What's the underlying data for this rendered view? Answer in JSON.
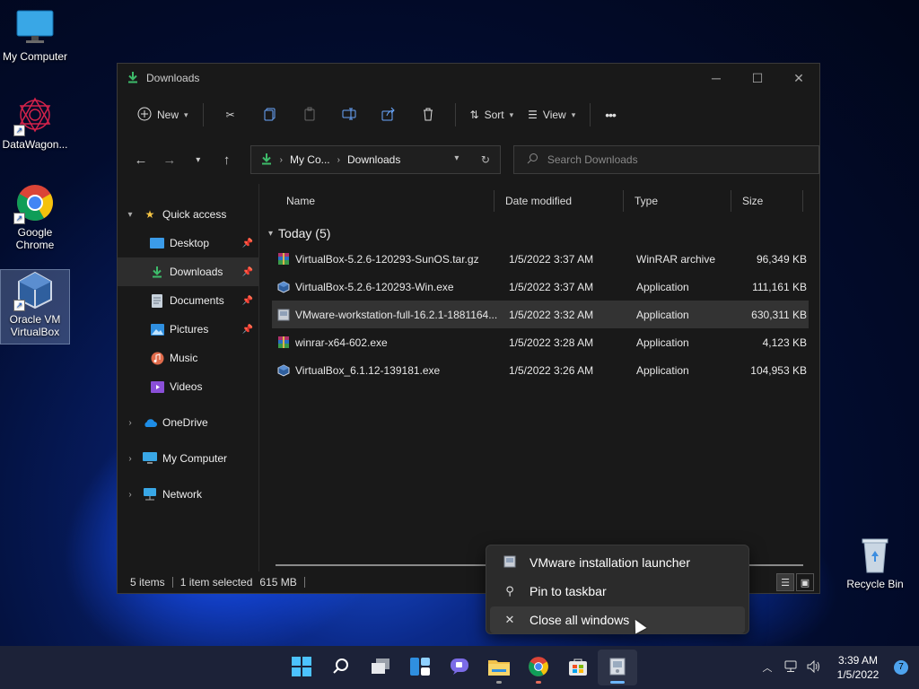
{
  "desktop": {
    "icons": [
      {
        "label": "My Computer"
      },
      {
        "label": "DataWagon..."
      },
      {
        "label": "Google Chrome"
      },
      {
        "label": "Oracle VM VirtualBox"
      },
      {
        "label": "Recycle Bin"
      }
    ]
  },
  "window": {
    "title": "Downloads",
    "toolbar": {
      "new_label": "New",
      "sort_label": "Sort",
      "view_label": "View",
      "more_label": "•••"
    },
    "address": {
      "crumb1": "My Co...",
      "crumb2": "Downloads"
    },
    "search": {
      "placeholder": "Search Downloads"
    },
    "sidebar": {
      "quick_access": "Quick access",
      "items": [
        {
          "label": "Desktop"
        },
        {
          "label": "Downloads"
        },
        {
          "label": "Documents"
        },
        {
          "label": "Pictures"
        },
        {
          "label": "Music"
        },
        {
          "label": "Videos"
        }
      ],
      "onedrive": "OneDrive",
      "my_computer": "My Computer",
      "network": "Network"
    },
    "columns": {
      "name": "Name",
      "date": "Date modified",
      "type": "Type",
      "size": "Size"
    },
    "group_label": "Today (5)",
    "files": [
      {
        "name": "VirtualBox-5.2.6-120293-SunOS.tar.gz",
        "date": "1/5/2022 3:37 AM",
        "type": "WinRAR archive",
        "size": "96,349 KB",
        "icon": "winrar-icon"
      },
      {
        "name": "VirtualBox-5.2.6-120293-Win.exe",
        "date": "1/5/2022 3:37 AM",
        "type": "Application",
        "size": "111,161 KB",
        "icon": "virtualbox-installer-icon"
      },
      {
        "name": "VMware-workstation-full-16.2.1-1881164...",
        "date": "1/5/2022 3:32 AM",
        "type": "Application",
        "size": "630,311 KB",
        "icon": "vmware-installer-icon"
      },
      {
        "name": "winrar-x64-602.exe",
        "date": "1/5/2022 3:28 AM",
        "type": "Application",
        "size": "4,123 KB",
        "icon": "winrar-icon"
      },
      {
        "name": "VirtualBox_6.1.12-139181.exe",
        "date": "1/5/2022 3:26 AM",
        "type": "Application",
        "size": "104,953 KB",
        "icon": "virtualbox-installer-icon"
      }
    ],
    "status": {
      "items": "5 items",
      "selected": "1 item selected",
      "size": "615 MB"
    }
  },
  "context_menu": {
    "items": [
      {
        "label": "VMware installation launcher"
      },
      {
        "label": "Pin to taskbar"
      },
      {
        "label": "Close all windows"
      }
    ]
  },
  "taskbar": {
    "time": "3:39 AM",
    "date": "1/5/2022",
    "notifications": "7"
  }
}
